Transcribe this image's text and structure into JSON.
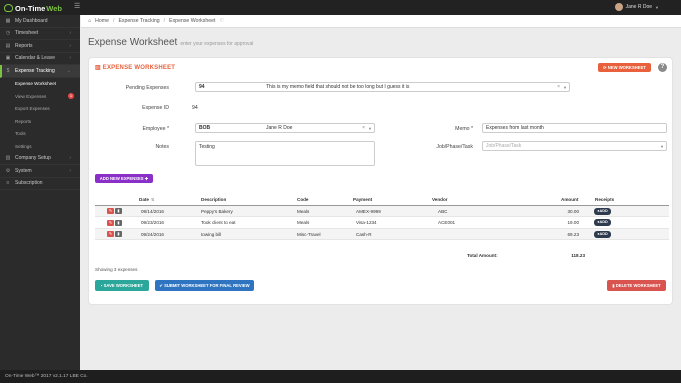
{
  "brand": {
    "name": "On-Time",
    "suffix": "Web"
  },
  "user": {
    "name": "Jane R Doe"
  },
  "sidebar": {
    "items": [
      {
        "label": "My Dashboard",
        "icon": "grid-icon"
      },
      {
        "label": "Timesheet",
        "icon": "clock-icon"
      },
      {
        "label": "Reports",
        "icon": "bar-chart-icon"
      },
      {
        "label": "Calendar & Leave",
        "icon": "calendar-icon"
      },
      {
        "label": "Expense Tracking",
        "icon": "dollar-icon"
      }
    ],
    "sub_items": [
      {
        "label": "Expense Worksheet"
      },
      {
        "label": "View Expenses",
        "badge": "1"
      },
      {
        "label": "Export Expenses"
      },
      {
        "label": "Reports"
      },
      {
        "label": "Tools"
      },
      {
        "label": "Settings"
      }
    ],
    "bottom_items": [
      {
        "label": "Company Setup",
        "icon": "building-icon"
      },
      {
        "label": "System",
        "icon": "gear-icon"
      },
      {
        "label": "Subscription",
        "icon": "list-icon"
      }
    ]
  },
  "breadcrumb": {
    "home": "Home",
    "section": "Expense Tracking",
    "page": "Expense Worksheet"
  },
  "page": {
    "title": "Expense Worksheet",
    "subtitle": "enter your expenses for approval"
  },
  "card": {
    "heading": "EXPENSE WORKSHEET",
    "new_ws_label": "NEW WORKSHEET",
    "help": "?"
  },
  "form": {
    "pending_label": "Pending Expenses",
    "pending_id": "94",
    "pending_memo": "This is my memo field that should not be too long but I guess it is",
    "expense_id_label": "Expense ID",
    "expense_id": "94",
    "employee_label": "Employee *",
    "employee_code": "BOB",
    "employee_name": "Jane R Doe",
    "memo_label": "Memo *",
    "memo_value": "Expenses from last month",
    "notes_label": "Notes",
    "notes_value": "Testing",
    "job_label": "Job/Phase/Task",
    "job_placeholder": "Job/Phase/Task"
  },
  "add_expense_label": "ADD NEW EXPENSES",
  "table": {
    "headers": [
      "Date",
      "Description",
      "Code",
      "Payment",
      "Vendor",
      "Amount",
      "Receipts"
    ],
    "rows": [
      {
        "date": "09/14/2016",
        "description": "Peppy's Bakery",
        "code": "Meals",
        "payment": "AMEX-9999",
        "vendor": "ABC",
        "amount": "30.00",
        "receipt": "ADD"
      },
      {
        "date": "09/23/2016",
        "description": "Took client to eat",
        "code": "Meals",
        "payment": "Visa-1234",
        "vendor": "ACE001",
        "amount": "19.00",
        "receipt": "ADD"
      },
      {
        "date": "09/24/2016",
        "description": "towing bill",
        "code": "Misc-Travel",
        "payment": "Cash-R",
        "vendor": "",
        "amount": "69.23",
        "receipt": "ADD"
      }
    ],
    "total_label": "Total Amount:",
    "total_value": "118.23",
    "showing": "Showing 3 expenses"
  },
  "actions": {
    "save": "SAVE WORKSHEET",
    "submit": "SUBMIT WORKSHEET FOR FINAL REVIEW",
    "delete": "DELETE WORKSHEET"
  },
  "footer": {
    "text": "On-Time Web™ 2017 v2.1.17   LBE Co."
  },
  "colors": {
    "accent": "#e8613c",
    "brand_green": "#7cc242",
    "purple": "#8b2fc9",
    "teal": "#2aa69a",
    "blue": "#2f74c0",
    "red": "#d9534f"
  }
}
